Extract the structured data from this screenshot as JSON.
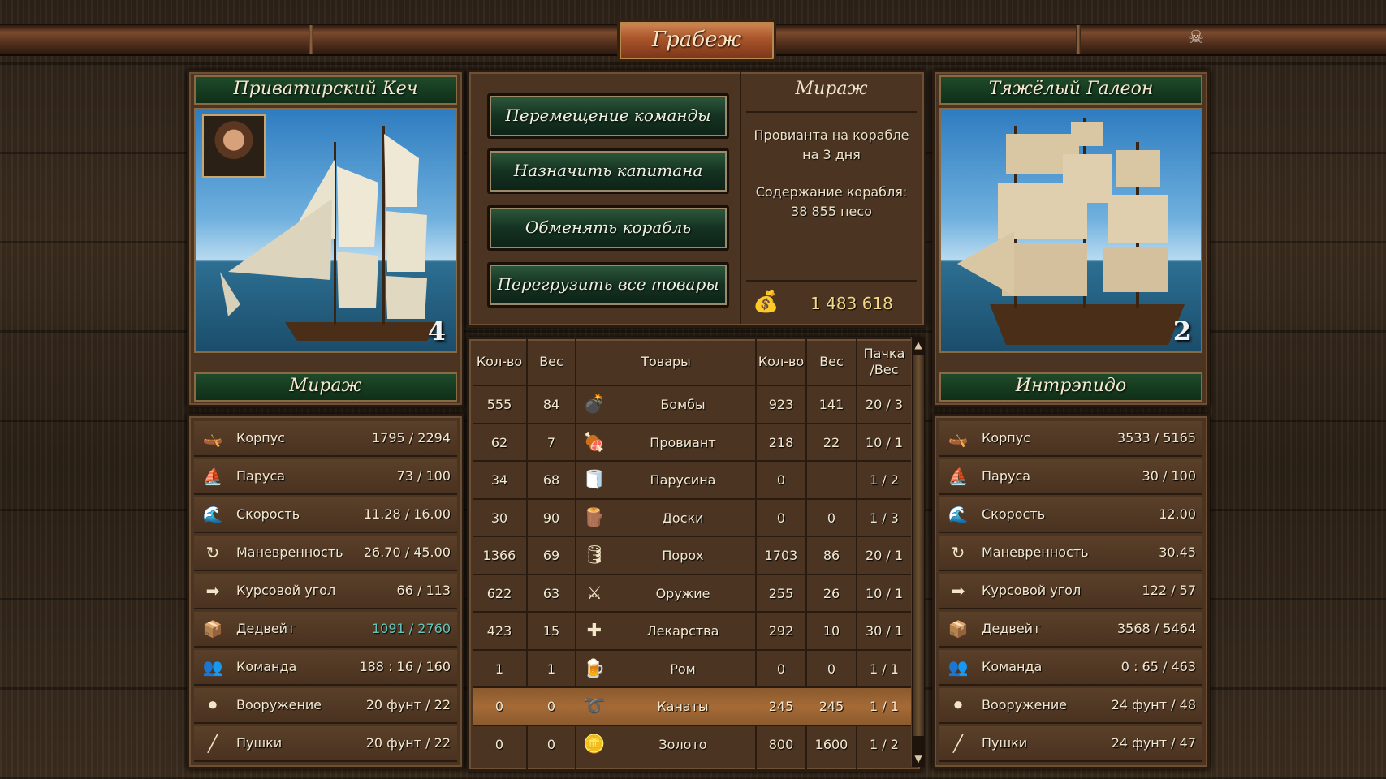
{
  "window": {
    "title": "Грабеж",
    "close_icon": "skull-crossbones-icon"
  },
  "left_ship": {
    "class_name": "Приватирский Кеч",
    "ship_name": "Мираж",
    "ship_class_number": "4",
    "stats": [
      {
        "icon": "hull-icon",
        "label": "Корпус",
        "value": "1795 / 2294"
      },
      {
        "icon": "sails-icon",
        "label": "Паруса",
        "value": "73 / 100"
      },
      {
        "icon": "speed-icon",
        "label": "Скорость",
        "value": "11.28 / 16.00"
      },
      {
        "icon": "maneuver-icon",
        "label": "Маневренность",
        "value": "26.70 / 45.00"
      },
      {
        "icon": "course-angle-icon",
        "label": "Курсовой угол",
        "value": "66 / 113"
      },
      {
        "icon": "deadweight-icon",
        "label": "Дедвейт",
        "value": "1091 / 2760"
      },
      {
        "icon": "crew-icon",
        "label": "Команда",
        "value": "188 : 16 / 160"
      },
      {
        "icon": "armament-icon",
        "label": "Вооружение",
        "value": "20 фунт / 22"
      },
      {
        "icon": "cannons-icon",
        "label": "Пушки",
        "value": "20 фунт / 22"
      }
    ]
  },
  "right_ship": {
    "class_name": "Тяжёлый Галеон",
    "ship_name": "Интрэпидо",
    "ship_class_number": "2",
    "stats": [
      {
        "icon": "hull-icon",
        "label": "Корпус",
        "value": "3533 / 5165"
      },
      {
        "icon": "sails-icon",
        "label": "Паруса",
        "value": "30 / 100"
      },
      {
        "icon": "speed-icon",
        "label": "Скорость",
        "value": "12.00"
      },
      {
        "icon": "maneuver-icon",
        "label": "Маневренность",
        "value": "30.45"
      },
      {
        "icon": "course-angle-icon",
        "label": "Курсовой угол",
        "value": "122 / 57"
      },
      {
        "icon": "deadweight-icon",
        "label": "Дедвейт",
        "value": "3568 / 5464"
      },
      {
        "icon": "crew-icon",
        "label": "Команда",
        "value": "0 : 65 / 463"
      },
      {
        "icon": "armament-icon",
        "label": "Вооружение",
        "value": "24 фунт / 48"
      },
      {
        "icon": "cannons-icon",
        "label": "Пушки",
        "value": "24 фунт / 47"
      }
    ]
  },
  "actions": {
    "move_crew": "Перемещение команды",
    "assign_captain": "Назначить капитана",
    "swap_ship": "Обменять корабль",
    "transfer_all": "Перегрузить все товары"
  },
  "info": {
    "ship_name": "Мираж",
    "provisions_line1": "Провианта на корабле",
    "provisions_line2": "на 3 дня",
    "upkeep_line1": "Содержание корабля:",
    "upkeep_line2": "38 855 песо",
    "money": "1 483 618"
  },
  "goods": {
    "headers": {
      "qty": "Кол-во",
      "weight": "Вес",
      "goods": "Товары",
      "qty2": "Кол-во",
      "weight2": "Вес",
      "pack_line1": "Пачка",
      "pack_line2": "/Вес"
    },
    "rows": [
      {
        "icon": "bombs-icon",
        "name": "Бомбы",
        "qty": "555",
        "weight": "84",
        "qty2": "923",
        "weight2": "141",
        "pack": "20 / 3"
      },
      {
        "icon": "provisions-icon",
        "name": "Провиант",
        "qty": "62",
        "weight": "7",
        "qty2": "218",
        "weight2": "22",
        "pack": "10 / 1"
      },
      {
        "icon": "sailcloth-icon",
        "name": "Парусина",
        "qty": "34",
        "weight": "68",
        "qty2": "0",
        "weight2": "",
        "pack": "1 / 2"
      },
      {
        "icon": "planks-icon",
        "name": "Доски",
        "qty": "30",
        "weight": "90",
        "qty2": "0",
        "weight2": "0",
        "pack": "1 / 3"
      },
      {
        "icon": "gunpowder-icon",
        "name": "Порох",
        "qty": "1366",
        "weight": "69",
        "qty2": "1703",
        "weight2": "86",
        "pack": "20 / 1"
      },
      {
        "icon": "weapons-icon",
        "name": "Оружие",
        "qty": "622",
        "weight": "63",
        "qty2": "255",
        "weight2": "26",
        "pack": "10 / 1"
      },
      {
        "icon": "medicine-icon",
        "name": "Лекарства",
        "qty": "423",
        "weight": "15",
        "qty2": "292",
        "weight2": "10",
        "pack": "30 / 1"
      },
      {
        "icon": "rum-icon",
        "name": "Ром",
        "qty": "1",
        "weight": "1",
        "qty2": "0",
        "weight2": "0",
        "pack": "1 / 1"
      },
      {
        "icon": "ropes-icon",
        "name": "Канаты",
        "qty": "0",
        "weight": "0",
        "qty2": "245",
        "weight2": "245",
        "pack": "1 / 1",
        "selected": true
      },
      {
        "icon": "gold-icon",
        "name": "Золото",
        "qty": "0",
        "weight": "0",
        "qty2": "800",
        "weight2": "1600",
        "pack": "1 / 2"
      }
    ]
  },
  "colors": {
    "header_green": "#1f4a2a",
    "highlight_value": "#5fc8c0",
    "selected_row": "#a56a36",
    "money": "#f0d98a"
  }
}
